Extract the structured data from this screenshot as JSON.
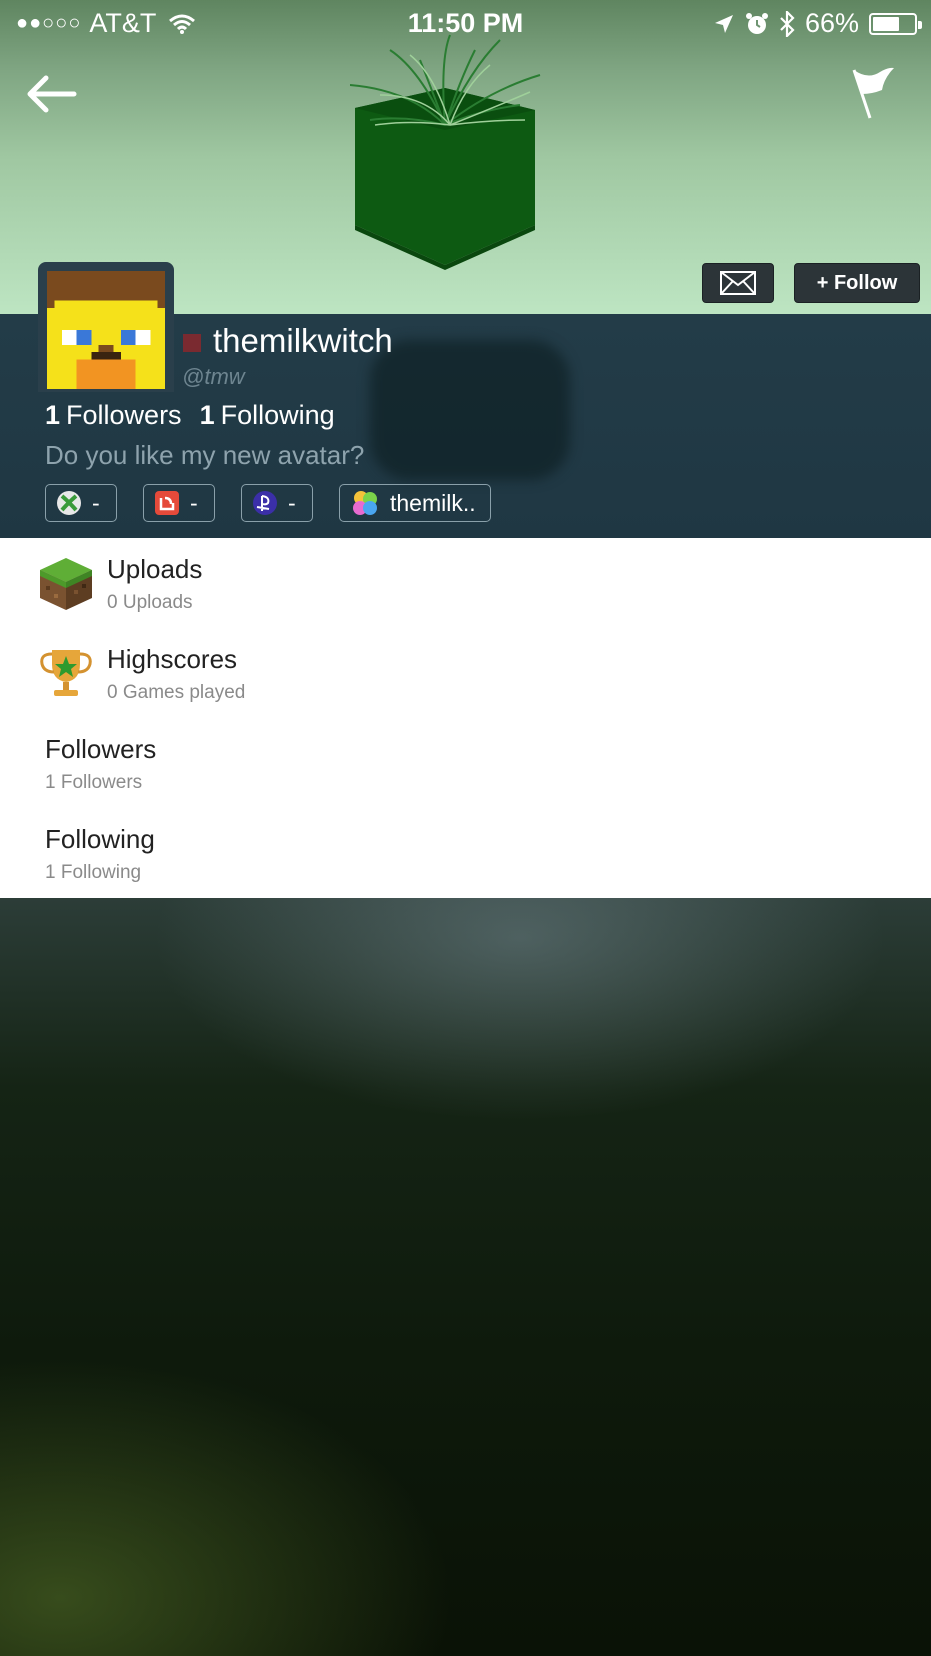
{
  "status_bar": {
    "signal_dots": "●●○○○",
    "carrier": "AT&T",
    "time": "11:50 PM",
    "battery_percent": "66%",
    "battery_level": 0.66,
    "icons": [
      "wifi-icon",
      "location-arrow-icon",
      "alarm-icon",
      "bluetooth-icon",
      "battery-icon"
    ]
  },
  "nav": {
    "back_icon": "back-arrow-icon",
    "report_icon": "flag-icon"
  },
  "actions": {
    "message_icon": "mail-icon",
    "follow_label": "+ Follow"
  },
  "profile": {
    "username": "themilkwitch",
    "handle": "@tmw",
    "followers_count": "1",
    "followers_label": "Followers",
    "following_count": "1",
    "following_label": "Following",
    "bio": "Do you like my new avatar?",
    "status_color": "#7a2a30",
    "badges": [
      {
        "icon": "xbox-icon",
        "value": "-"
      },
      {
        "icon": "kik-icon",
        "value": "-"
      },
      {
        "icon": "playstation-icon",
        "value": "-"
      },
      {
        "icon": "game-center-icon",
        "value": "themilk.."
      }
    ]
  },
  "sections": [
    {
      "icon": "grass-block-icon",
      "title": "Uploads",
      "subtitle": "0 Uploads"
    },
    {
      "icon": "trophy-icon",
      "title": "Highscores",
      "subtitle": "0 Games played"
    },
    {
      "title": "Followers",
      "subtitle": "1 Followers"
    },
    {
      "title": "Following",
      "subtitle": "1 Following"
    }
  ],
  "colors": {
    "header_panel": "#233c48",
    "button_bg": "#2c3438",
    "banner_green": "#bde5c2"
  }
}
